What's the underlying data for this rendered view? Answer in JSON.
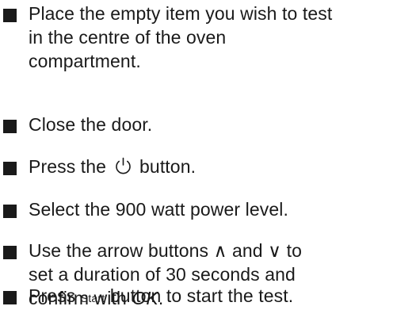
{
  "steps": [
    {
      "lines": [
        "Place the empty item you wish to test",
        "in the centre of the oven",
        "compartment."
      ]
    },
    {
      "lines": [
        "Close the door."
      ]
    },
    {
      "before": "Press the ",
      "icon": "power-icon",
      "after": " button."
    },
    {
      "lines": [
        "Select the 900 watt power level."
      ]
    },
    {
      "lines": [
        "Use the arrow buttons ∧ and ∨ to",
        "set a duration of 30 seconds and"
      ],
      "last_before": "confirm with ",
      "last_italic": "OK",
      "last_after": "."
    },
    {
      "before": "Press ",
      "key_label": "Start",
      "after": " button to start the test."
    }
  ]
}
